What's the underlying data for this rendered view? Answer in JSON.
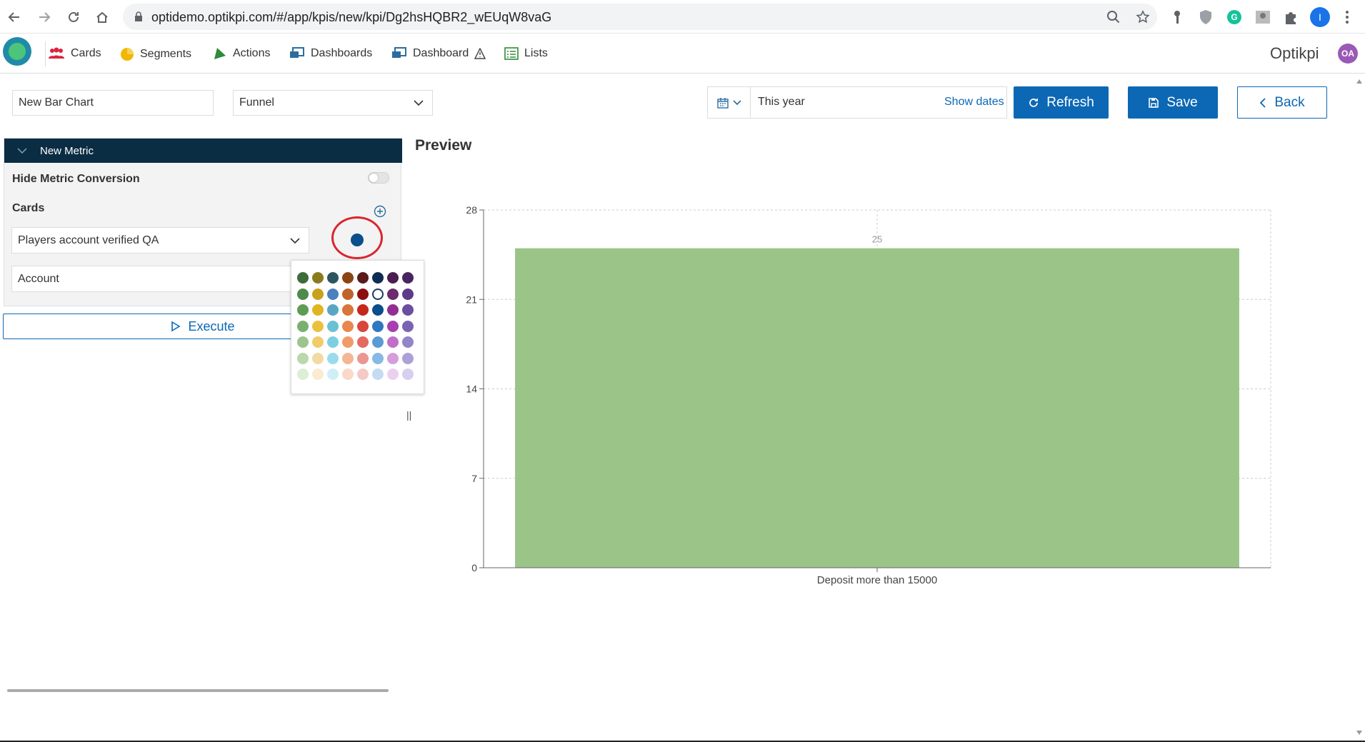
{
  "browser": {
    "url_main": "optidemo.optikpi.com/#/app/kpis/new/kpi/Dg2hsHQBR2_wEUqW8vaG",
    "profile_initial": "I"
  },
  "header": {
    "nav": [
      {
        "label": "Cards",
        "icon": "users-icon"
      },
      {
        "label": "Segments",
        "icon": "pie-chart-icon"
      },
      {
        "label": "Actions",
        "icon": "send-icon"
      },
      {
        "label": "Dashboards",
        "icon": "monitor-icon"
      },
      {
        "label": "Dashboard",
        "icon": "monitor-icon"
      },
      {
        "label": "Lists",
        "icon": "list-icon"
      }
    ],
    "brand": "Optikpi",
    "user_initials": "OA"
  },
  "toolbar": {
    "chart_name": "New Bar Chart",
    "chart_kind": "Funnel",
    "date_range": "This year",
    "show_dates": "Show dates",
    "refresh": "Refresh",
    "save": "Save",
    "back": "Back"
  },
  "metric": {
    "title": "New Metric",
    "hide_conversion_label": "Hide Metric Conversion",
    "hide_conversion_on": false,
    "cards_label": "Cards",
    "card_value": "Players account verified QA",
    "second_value": "Account",
    "selected_color": "#0b4e8c",
    "execute": "Execute"
  },
  "palette": [
    [
      "#3d6b3a",
      "#8a7b1c",
      "#2d5560",
      "#8b4513",
      "#5a1a1a",
      "#0f2d52",
      "#4a1f4f",
      "#4a2460"
    ],
    [
      "#4e8a4a",
      "#c9a21b",
      "#4a80bd",
      "#c0632a",
      "#8b0f0f",
      "#ffffff",
      "#6c2a6f",
      "#5e3a8a"
    ],
    [
      "#5e9c56",
      "#e0b522",
      "#5aa6c2",
      "#d9743a",
      "#c4281a",
      "#0b4e8c",
      "#922e93",
      "#6b4ea0"
    ],
    [
      "#79b06f",
      "#ebc03d",
      "#6ac1d2",
      "#e8884e",
      "#d8473d",
      "#2e78c2",
      "#a83fb0",
      "#7c62b2"
    ],
    [
      "#9cc48f",
      "#f0cc6a",
      "#7ccfe0",
      "#f09b6b",
      "#e36a5f",
      "#5b9bd6",
      "#c06fc9",
      "#9484c8"
    ],
    [
      "#b9d8ab",
      "#f3daa0",
      "#98dcec",
      "#f4b594",
      "#eb9691",
      "#86b9e4",
      "#d69ddc",
      "#ad9fd8"
    ],
    [
      "#dceed4",
      "#f9ecd0",
      "#cfeff7",
      "#fad9c8",
      "#f4c9c6",
      "#c3dcf1",
      "#ecd0ef",
      "#d6cfee"
    ]
  ],
  "preview": {
    "title": "Preview"
  },
  "chart_data": {
    "type": "bar",
    "categories": [
      "Deposit more than 15000"
    ],
    "values": [
      25
    ],
    "ylim": [
      0,
      28
    ],
    "yticks": [
      0,
      7,
      14,
      21,
      28
    ],
    "bar_color": "#9bc488",
    "data_labels": [
      "25"
    ],
    "grid": true
  }
}
